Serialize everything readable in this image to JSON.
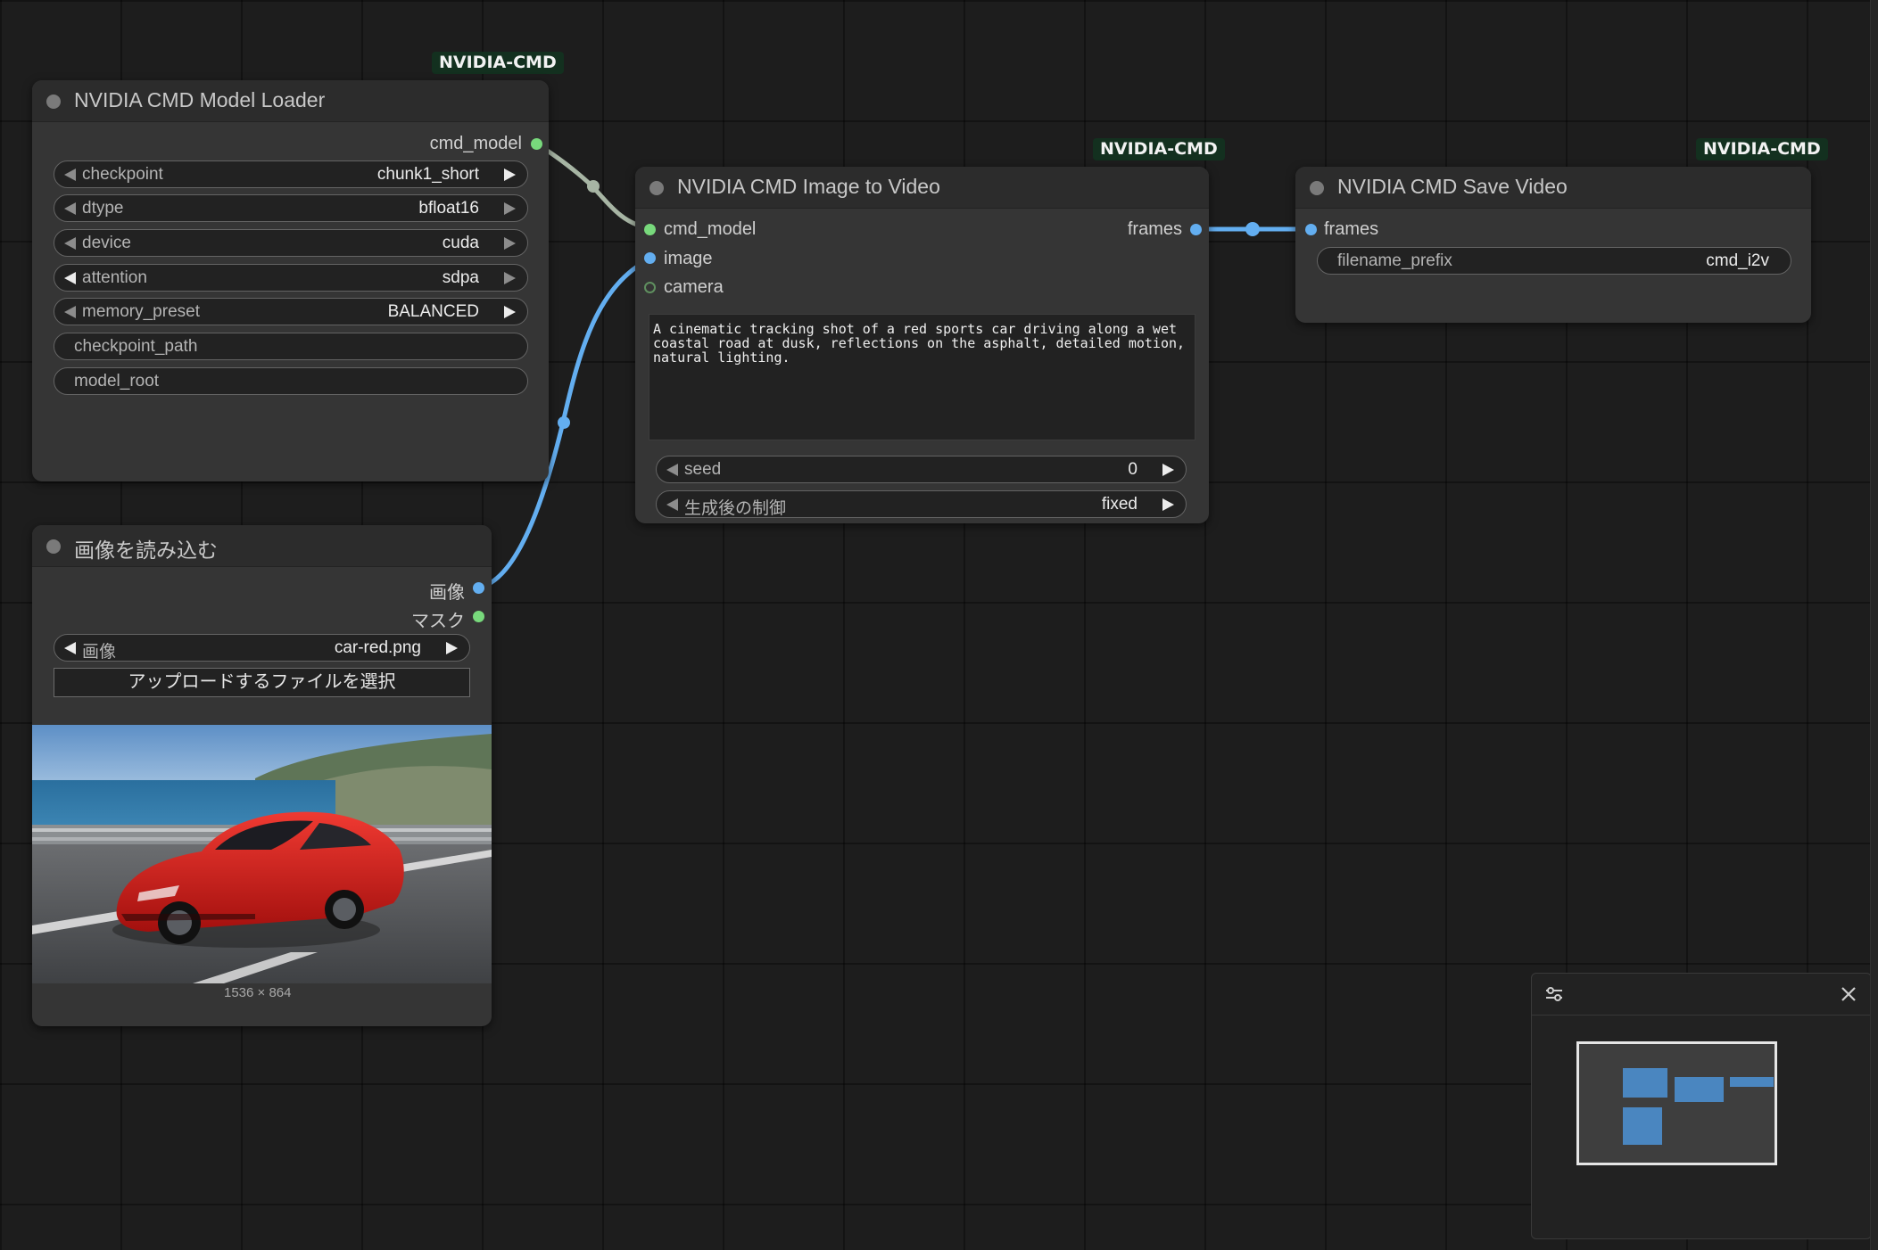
{
  "loader_node": {
    "badge": "NVIDIA-CMD",
    "title": "NVIDIA CMD Model Loader",
    "output_label": "cmd_model",
    "widgets": [
      {
        "label": "checkpoint",
        "value": "chunk1_short"
      },
      {
        "label": "dtype",
        "value": "bfloat16"
      },
      {
        "label": "device",
        "value": "cuda"
      },
      {
        "label": "attention",
        "value": "sdpa"
      },
      {
        "label": "memory_preset",
        "value": "BALANCED"
      }
    ],
    "text_widgets": [
      "checkpoint_path",
      "model_root"
    ]
  },
  "image_loader_node": {
    "title": "画像を読み込む",
    "outputs": [
      "画像",
      "マスク"
    ],
    "image_widget": {
      "label": "画像",
      "value": "car-red.png"
    },
    "upload_button": "アップロードするファイルを選択",
    "image_size": "1536 × 864"
  },
  "i2v_node": {
    "badge": "NVIDIA-CMD",
    "title": "NVIDIA CMD Image to Video",
    "inputs": [
      "cmd_model",
      "image",
      "camera"
    ],
    "output_label": "frames",
    "prompt": "A cinematic tracking shot of a red sports car driving along a wet coastal road at dusk, reflections on the asphalt, detailed motion, natural lighting.",
    "widgets": [
      {
        "label": "seed",
        "value": "0"
      },
      {
        "label": "生成後の制御",
        "value": "fixed"
      }
    ]
  },
  "save_node": {
    "badge": "NVIDIA-CMD",
    "title": "NVIDIA CMD Save Video",
    "input_label": "frames",
    "widget": {
      "label": "filename_prefix",
      "value": "cmd_i2v"
    }
  },
  "minimap": {
    "settings_icon": "sliders-icon",
    "close_icon": "close-icon"
  },
  "colors": {
    "canvas": "#1d1d1d",
    "node_body": "#353535",
    "model_link": "#a7b5a4",
    "image_link": "#63aef0",
    "badge_bg": "#13301f"
  }
}
